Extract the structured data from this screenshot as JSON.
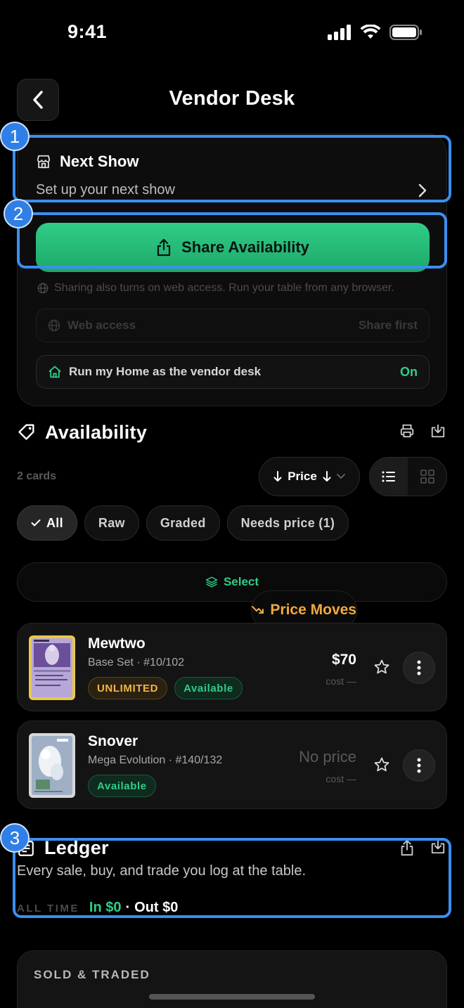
{
  "status_bar": {
    "time": "9:41"
  },
  "header": {
    "title": "Vendor Desk"
  },
  "next_show": {
    "title": "Next Show",
    "subtitle": "Set up your next show"
  },
  "share": {
    "button_label": "Share Availability",
    "note": "Sharing also turns on web access. Run your table from any browser.",
    "web_access_label": "Web access",
    "web_access_state": "Share first",
    "home_vendor_label": "Run my Home as the vendor desk",
    "home_vendor_state": "On"
  },
  "availability": {
    "title": "Availability",
    "count": "2 cards",
    "sort_label": "Price",
    "filters": [
      {
        "label": "All",
        "active": true
      },
      {
        "label": "Raw",
        "active": false
      },
      {
        "label": "Graded",
        "active": false
      },
      {
        "label": "Needs price (1)",
        "active": false
      }
    ],
    "price_moves_label": "Price Moves",
    "select_label": "Select",
    "cards": [
      {
        "name": "Mewtwo",
        "set": "Base Set · #10/102",
        "badges": [
          "UNLIMITED",
          "Available"
        ],
        "price": "$70",
        "cost": "cost —"
      },
      {
        "name": "Snover",
        "set": "Mega Evolution · #140/132",
        "badges": [
          "Available"
        ],
        "price": "No price",
        "cost": "cost —"
      }
    ]
  },
  "ledger": {
    "title": "Ledger",
    "description": "Every sale, buy, and trade you log at the table.",
    "period": "ALL TIME",
    "in": "In $0",
    "separator": "·",
    "out": "Out $0"
  },
  "sold_traded": {
    "title": "SOLD & TRADED"
  },
  "callouts": [
    "1",
    "2",
    "3"
  ],
  "colors": {
    "accent_green": "#2fcd86",
    "accent_orange": "#f0a93b",
    "callout_blue": "#3b8ff0",
    "background": "#000000"
  }
}
